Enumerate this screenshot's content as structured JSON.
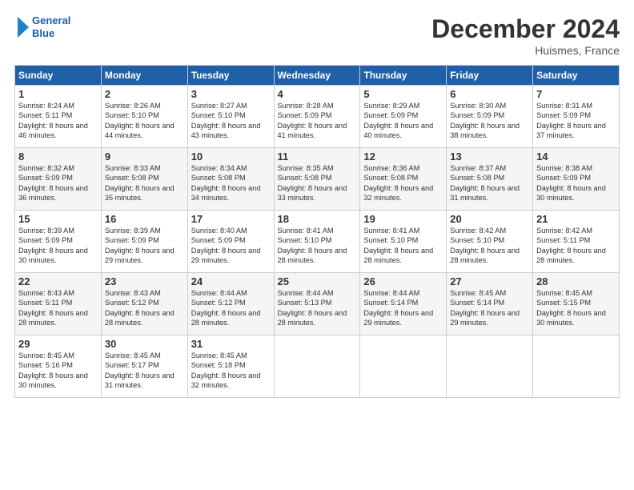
{
  "header": {
    "logo_line1": "General",
    "logo_line2": "Blue",
    "title": "December 2024",
    "location": "Huismes, France"
  },
  "weekdays": [
    "Sunday",
    "Monday",
    "Tuesday",
    "Wednesday",
    "Thursday",
    "Friday",
    "Saturday"
  ],
  "weeks": [
    [
      {
        "day": "1",
        "sunrise": "Sunrise: 8:24 AM",
        "sunset": "Sunset: 5:11 PM",
        "daylight": "Daylight: 8 hours and 46 minutes."
      },
      {
        "day": "2",
        "sunrise": "Sunrise: 8:26 AM",
        "sunset": "Sunset: 5:10 PM",
        "daylight": "Daylight: 8 hours and 44 minutes."
      },
      {
        "day": "3",
        "sunrise": "Sunrise: 8:27 AM",
        "sunset": "Sunset: 5:10 PM",
        "daylight": "Daylight: 8 hours and 43 minutes."
      },
      {
        "day": "4",
        "sunrise": "Sunrise: 8:28 AM",
        "sunset": "Sunset: 5:09 PM",
        "daylight": "Daylight: 8 hours and 41 minutes."
      },
      {
        "day": "5",
        "sunrise": "Sunrise: 8:29 AM",
        "sunset": "Sunset: 5:09 PM",
        "daylight": "Daylight: 8 hours and 40 minutes."
      },
      {
        "day": "6",
        "sunrise": "Sunrise: 8:30 AM",
        "sunset": "Sunset: 5:09 PM",
        "daylight": "Daylight: 8 hours and 38 minutes."
      },
      {
        "day": "7",
        "sunrise": "Sunrise: 8:31 AM",
        "sunset": "Sunset: 5:09 PM",
        "daylight": "Daylight: 8 hours and 37 minutes."
      }
    ],
    [
      {
        "day": "8",
        "sunrise": "Sunrise: 8:32 AM",
        "sunset": "Sunset: 5:09 PM",
        "daylight": "Daylight: 8 hours and 36 minutes."
      },
      {
        "day": "9",
        "sunrise": "Sunrise: 8:33 AM",
        "sunset": "Sunset: 5:08 PM",
        "daylight": "Daylight: 8 hours and 35 minutes."
      },
      {
        "day": "10",
        "sunrise": "Sunrise: 8:34 AM",
        "sunset": "Sunset: 5:08 PM",
        "daylight": "Daylight: 8 hours and 34 minutes."
      },
      {
        "day": "11",
        "sunrise": "Sunrise: 8:35 AM",
        "sunset": "Sunset: 5:08 PM",
        "daylight": "Daylight: 8 hours and 33 minutes."
      },
      {
        "day": "12",
        "sunrise": "Sunrise: 8:36 AM",
        "sunset": "Sunset: 5:08 PM",
        "daylight": "Daylight: 8 hours and 32 minutes."
      },
      {
        "day": "13",
        "sunrise": "Sunrise: 8:37 AM",
        "sunset": "Sunset: 5:08 PM",
        "daylight": "Daylight: 8 hours and 31 minutes."
      },
      {
        "day": "14",
        "sunrise": "Sunrise: 8:38 AM",
        "sunset": "Sunset: 5:09 PM",
        "daylight": "Daylight: 8 hours and 30 minutes."
      }
    ],
    [
      {
        "day": "15",
        "sunrise": "Sunrise: 8:39 AM",
        "sunset": "Sunset: 5:09 PM",
        "daylight": "Daylight: 8 hours and 30 minutes."
      },
      {
        "day": "16",
        "sunrise": "Sunrise: 8:39 AM",
        "sunset": "Sunset: 5:09 PM",
        "daylight": "Daylight: 8 hours and 29 minutes."
      },
      {
        "day": "17",
        "sunrise": "Sunrise: 8:40 AM",
        "sunset": "Sunset: 5:09 PM",
        "daylight": "Daylight: 8 hours and 29 minutes."
      },
      {
        "day": "18",
        "sunrise": "Sunrise: 8:41 AM",
        "sunset": "Sunset: 5:10 PM",
        "daylight": "Daylight: 8 hours and 28 minutes."
      },
      {
        "day": "19",
        "sunrise": "Sunrise: 8:41 AM",
        "sunset": "Sunset: 5:10 PM",
        "daylight": "Daylight: 8 hours and 28 minutes."
      },
      {
        "day": "20",
        "sunrise": "Sunrise: 8:42 AM",
        "sunset": "Sunset: 5:10 PM",
        "daylight": "Daylight: 8 hours and 28 minutes."
      },
      {
        "day": "21",
        "sunrise": "Sunrise: 8:42 AM",
        "sunset": "Sunset: 5:11 PM",
        "daylight": "Daylight: 8 hours and 28 minutes."
      }
    ],
    [
      {
        "day": "22",
        "sunrise": "Sunrise: 8:43 AM",
        "sunset": "Sunset: 5:11 PM",
        "daylight": "Daylight: 8 hours and 28 minutes."
      },
      {
        "day": "23",
        "sunrise": "Sunrise: 8:43 AM",
        "sunset": "Sunset: 5:12 PM",
        "daylight": "Daylight: 8 hours and 28 minutes."
      },
      {
        "day": "24",
        "sunrise": "Sunrise: 8:44 AM",
        "sunset": "Sunset: 5:12 PM",
        "daylight": "Daylight: 8 hours and 28 minutes."
      },
      {
        "day": "25",
        "sunrise": "Sunrise: 8:44 AM",
        "sunset": "Sunset: 5:13 PM",
        "daylight": "Daylight: 8 hours and 28 minutes."
      },
      {
        "day": "26",
        "sunrise": "Sunrise: 8:44 AM",
        "sunset": "Sunset: 5:14 PM",
        "daylight": "Daylight: 8 hours and 29 minutes."
      },
      {
        "day": "27",
        "sunrise": "Sunrise: 8:45 AM",
        "sunset": "Sunset: 5:14 PM",
        "daylight": "Daylight: 8 hours and 29 minutes."
      },
      {
        "day": "28",
        "sunrise": "Sunrise: 8:45 AM",
        "sunset": "Sunset: 5:15 PM",
        "daylight": "Daylight: 8 hours and 30 minutes."
      }
    ],
    [
      {
        "day": "29",
        "sunrise": "Sunrise: 8:45 AM",
        "sunset": "Sunset: 5:16 PM",
        "daylight": "Daylight: 8 hours and 30 minutes."
      },
      {
        "day": "30",
        "sunrise": "Sunrise: 8:45 AM",
        "sunset": "Sunset: 5:17 PM",
        "daylight": "Daylight: 8 hours and 31 minutes."
      },
      {
        "day": "31",
        "sunrise": "Sunrise: 8:45 AM",
        "sunset": "Sunset: 5:18 PM",
        "daylight": "Daylight: 8 hours and 32 minutes."
      },
      null,
      null,
      null,
      null
    ]
  ]
}
